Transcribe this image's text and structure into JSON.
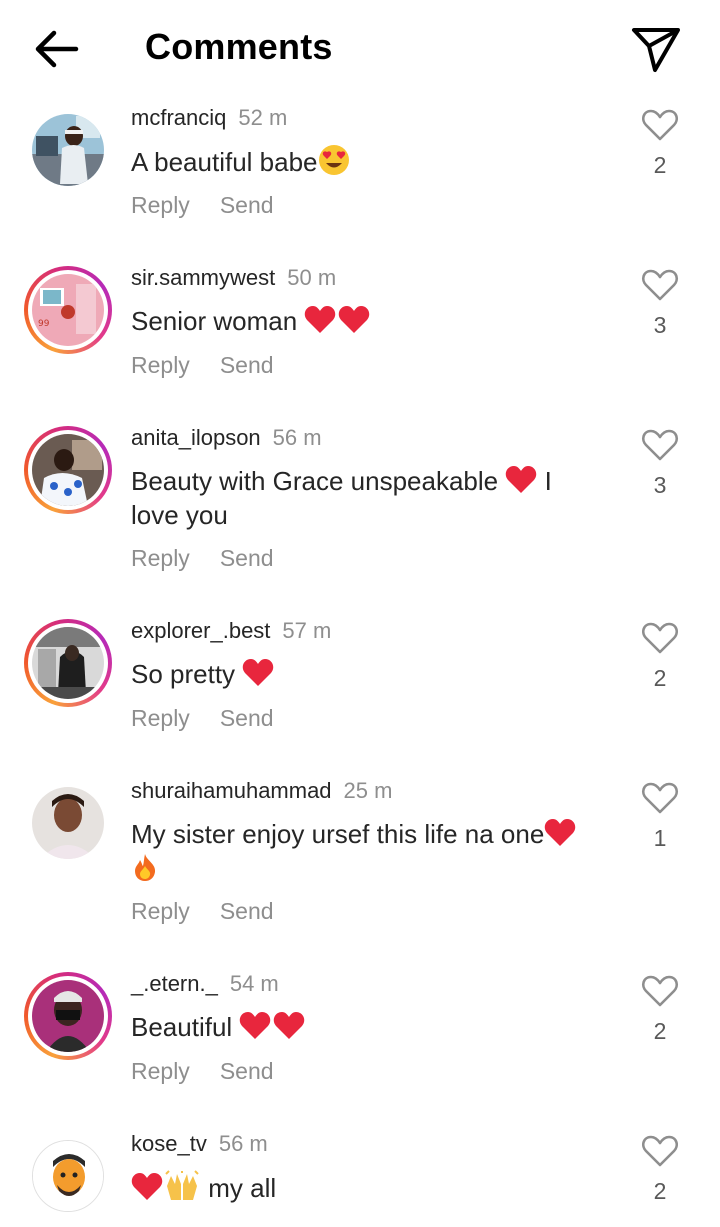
{
  "header": {
    "title": "Comments",
    "back_icon": "arrow-left-icon",
    "share_icon": "paper-plane-icon"
  },
  "comments": [
    {
      "username": "mcfranciq",
      "time": "52 m",
      "text": "A beautiful babe",
      "emoji_after": [
        "heart-eyes"
      ],
      "likes": "2",
      "story_ring": false
    },
    {
      "username": "sir.sammywest",
      "time": "50 m",
      "text": "Senior woman ",
      "emoji_after": [
        "red-heart",
        "red-heart"
      ],
      "likes": "3",
      "story_ring": true
    },
    {
      "username": "anita_ilopson",
      "time": "56 m",
      "text": "Beauty with Grace unspeakable",
      "emoji_after": [
        "red-heart"
      ],
      "text_tail": " I love you",
      "likes": "3",
      "story_ring": true
    },
    {
      "username": "explorer_.best",
      "time": "57 m",
      "text": "So pretty ",
      "emoji_after": [
        "red-heart"
      ],
      "likes": "2",
      "story_ring": true
    },
    {
      "username": "shuraihamuhammad",
      "time": "25 m",
      "text": "My sister enjoy ursef this life na one",
      "emoji_after": [
        "red-heart",
        "fire"
      ],
      "likes": "1",
      "story_ring": false
    },
    {
      "username": "_.etern._",
      "time": "54 m",
      "text": "Beautiful ",
      "emoji_after": [
        "red-heart",
        "red-heart"
      ],
      "likes": "2",
      "story_ring": true
    },
    {
      "username": "kose_tv",
      "time": "56 m",
      "text": " my all",
      "emoji_before": [
        "red-heart",
        "raising-hands"
      ],
      "likes": "2",
      "story_ring": false
    }
  ],
  "labels": {
    "reply": "Reply",
    "send": "Send"
  },
  "colors": {
    "text": "#262626",
    "muted": "#8e8e8e",
    "ring_start": "#f9a13a",
    "ring_end": "#b62ab8"
  }
}
